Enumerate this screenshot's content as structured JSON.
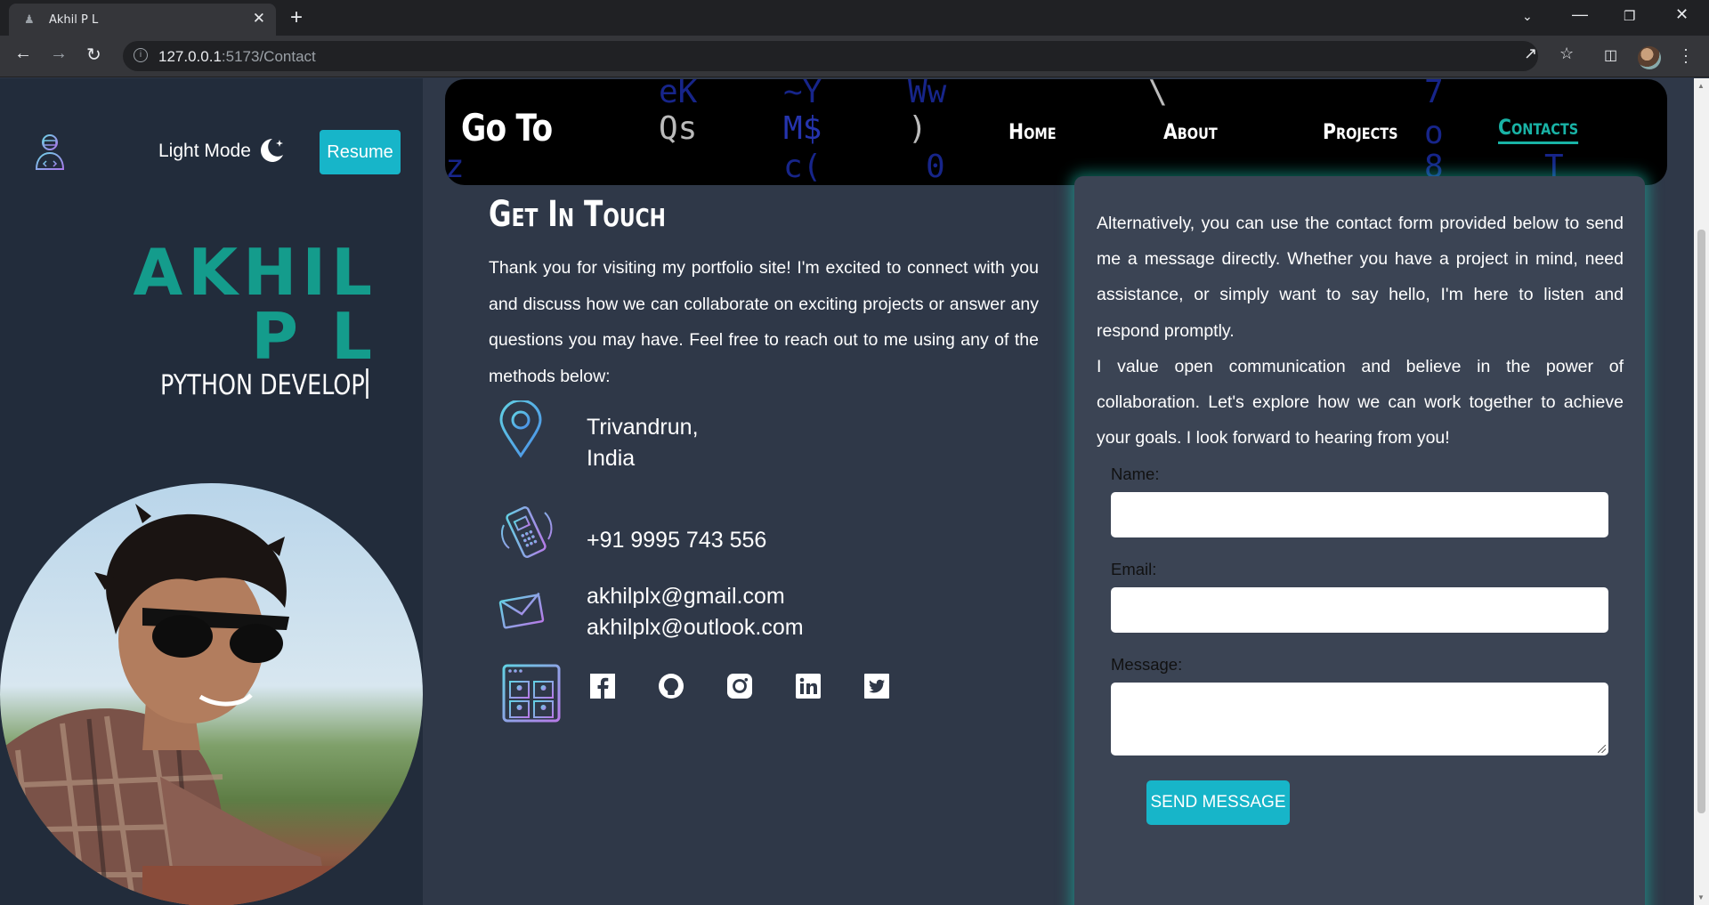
{
  "browser": {
    "tab_title": "Akhil P L",
    "url_host": "127.0.0.1",
    "url_path": ":5173/Contact"
  },
  "sidebar": {
    "light_mode_label": "Light Mode",
    "resume_label": "Resume",
    "name_line1": "AKHIL",
    "name_line2": "P L",
    "role_typed": "PYTHON DEVELOP"
  },
  "nav": {
    "brand": "Go To",
    "links": [
      "Home",
      "About",
      "Projects",
      "Contacts"
    ],
    "active": "Contacts"
  },
  "contact": {
    "heading": "Get In Touch",
    "intro": "Thank you for visiting my portfolio site! I'm excited to connect with you and discuss how we can collaborate on exciting projects or answer any questions you may have. Feel free to reach out to me using any of the methods below:",
    "location_line1": "Trivandrun,",
    "location_line2": "India",
    "phone": "+91 9995 743 556",
    "email1": "akhilplx@gmail.com",
    "email2": "akhilplx@outlook.com",
    "socials": [
      "facebook-icon",
      "github-icon",
      "instagram-icon",
      "linkedin-icon",
      "twitter-icon"
    ]
  },
  "form_card": {
    "paragraph1": "Alternatively, you can use the contact form provided below to send me a message directly. Whether you have a project in mind, need assistance, or simply want to say hello, I'm here to listen and respond promptly.",
    "paragraph2": "I value open communication and believe in the power of collaboration. Let's explore how we can work together to achieve your goals. I look forward to hearing from you!",
    "name_label": "Name:",
    "email_label": "Email:",
    "message_label": "Message:",
    "name_value": "",
    "email_value": "",
    "message_value": "",
    "submit_label": "SEND MESSAGE"
  },
  "colors": {
    "accent_teal": "#149c8c",
    "button_cyan": "#17b5c9",
    "sidebar_bg": "#222c3b",
    "page_bg": "#2f3848",
    "card_bg": "#3b4454"
  }
}
